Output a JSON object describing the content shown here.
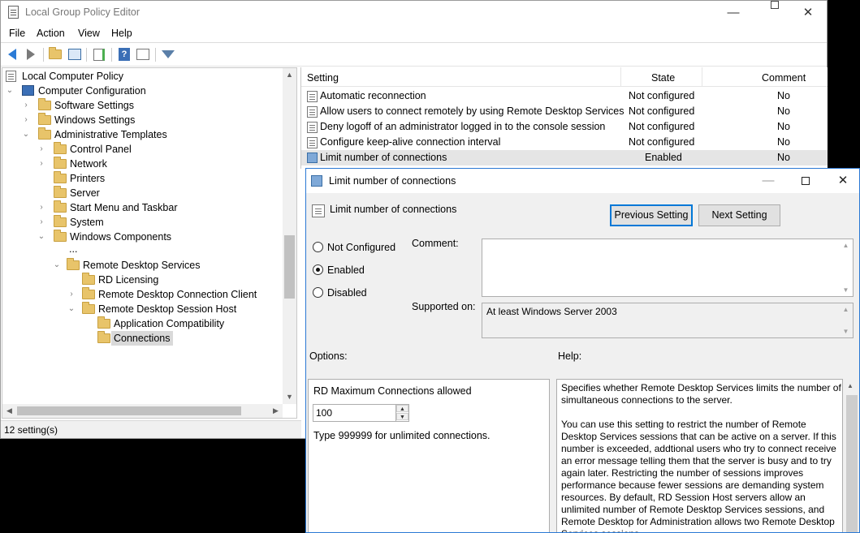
{
  "window": {
    "title": "Local Group Policy Editor",
    "minimize": "—",
    "maximize": "",
    "close": "✕"
  },
  "menu": [
    "File",
    "Action",
    "View",
    "Help"
  ],
  "toolbar": [
    "back-icon",
    "forward-icon",
    "up-folder-icon",
    "show-hide-tree-icon",
    "export-list-icon",
    "help-icon",
    "properties-icon",
    "filter-icon"
  ],
  "tree": {
    "items": [
      {
        "label": "Local Computer Policy"
      },
      {
        "label": "Computer Configuration"
      },
      {
        "label": "Software Settings"
      },
      {
        "label": "Windows Settings"
      },
      {
        "label": "Administrative Templates"
      },
      {
        "label": "Control Panel"
      },
      {
        "label": "Network"
      },
      {
        "label": "Printers"
      },
      {
        "label": "Server"
      },
      {
        "label": "Start Menu and Taskbar"
      },
      {
        "label": "System"
      },
      {
        "label": "Windows Components"
      },
      {
        "label": "..."
      },
      {
        "label": "Remote Desktop Services"
      },
      {
        "label": "RD Licensing"
      },
      {
        "label": "Remote Desktop Connection Client"
      },
      {
        "label": "Remote Desktop Session Host"
      },
      {
        "label": "Application Compatibility"
      },
      {
        "label": "Connections"
      }
    ]
  },
  "status": "12 setting(s)",
  "list": {
    "headers": {
      "setting": "Setting",
      "state": "State",
      "comment": "Comment"
    },
    "rows": [
      {
        "setting": "Automatic reconnection",
        "state": "Not configured",
        "comment": "No"
      },
      {
        "setting": "Allow users to connect remotely by using Remote Desktop Services",
        "state": "Not configured",
        "comment": "No"
      },
      {
        "setting": "Deny logoff of an administrator logged in to the console session",
        "state": "Not configured",
        "comment": "No"
      },
      {
        "setting": "Configure keep-alive connection interval",
        "state": "Not configured",
        "comment": "No"
      },
      {
        "setting": "Limit number of connections",
        "state": "Enabled",
        "comment": "No"
      }
    ]
  },
  "dialog": {
    "title": "Limit number of connections",
    "setting_name": "Limit number of connections",
    "prev_button": "Previous Setting",
    "next_button": "Next Setting",
    "radios": [
      {
        "label": "Not Configured",
        "checked": false
      },
      {
        "label": "Enabled",
        "checked": true
      },
      {
        "label": "Disabled",
        "checked": false
      }
    ],
    "comment_label": "Comment:",
    "comment_value": "",
    "supported_label": "Supported on:",
    "supported_value": "At least Windows Server 2003",
    "options_label": "Options:",
    "help_label": "Help:",
    "option_field_label": "RD Maximum Connections allowed",
    "option_value": "100",
    "option_hint": "Type 999999 for unlimited connections.",
    "help_p1": "Specifies whether Remote Desktop Services limits the number of simultaneous connections to the server.",
    "help_p2": "You can use this setting to restrict the number of Remote Desktop Services sessions that can be active on a server. If this number is exceeded, addtional users who try to connect receive an error message telling them that the server is busy and to try again later. Restricting the number of sessions improves performance because fewer sessions are demanding system resources. By default, RD Session Host servers allow an unlimited number of Remote Desktop Services sessions, and Remote Desktop for Administration allows two Remote Desktop Services sessions."
  }
}
